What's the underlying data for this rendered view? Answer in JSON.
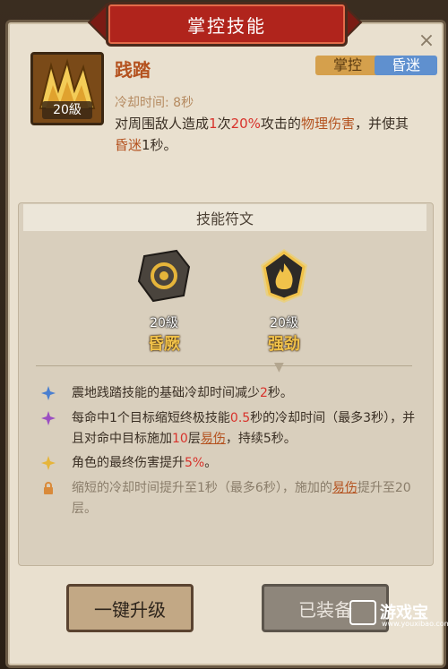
{
  "title": "掌控技能",
  "close_label": "×",
  "skill": {
    "name": "践踏",
    "level_badge": "20級",
    "tags": [
      "掌控",
      "昏迷"
    ],
    "cooldown": "冷却时间: 8秒",
    "description_parts": {
      "p1": "对周围敌人造成",
      "p2": "1",
      "p3": "次",
      "p4": "20%",
      "p5": "攻击的",
      "p6": "物理伤害",
      "p7": "，并使其",
      "p8": "昏迷",
      "p9": "1秒。"
    }
  },
  "runes": {
    "header": "技能符文",
    "items": [
      {
        "level": "20級",
        "name": "昏厥"
      },
      {
        "level": "20級",
        "name": "强劲"
      }
    ]
  },
  "effects": [
    {
      "icon": "blue-star-icon",
      "text_a": "震地践踏技能的基础冷却时间减少",
      "text_b": "2",
      "text_c": "秒。"
    },
    {
      "icon": "purple-star-icon",
      "text_a": "每命中1个目标缩短终极技能",
      "text_b": "0.5",
      "text_c": "秒的冷却时间（最多3秒），并且对命中目标施加",
      "text_d": "10",
      "text_e": "层",
      "text_f": "易伤",
      "text_g": "，持续5秒。"
    },
    {
      "icon": "yellow-star-icon",
      "text_a": "角色的最终伤害提升",
      "text_b": "5%",
      "text_c": "。"
    },
    {
      "icon": "lock-icon",
      "text_a": "缩短的冷却时间提升至1秒（最多6秒），施加的",
      "text_b": "易伤",
      "text_c": "提升至20层。"
    }
  ],
  "buttons": {
    "upgrade": "一键升级",
    "equipped": "已装备"
  },
  "watermark": {
    "text": "游戏宝",
    "sub": "www.youxibao.com"
  },
  "colors": {
    "banner_red": "#b0241c",
    "panel_bg": "#e9e0cf",
    "accent_red": "#d8322b",
    "accent_brown": "#b4521f",
    "rune_gold": "#f1c24a",
    "tag_ctrl": "#d5a04c",
    "tag_stun": "#5f90cf"
  }
}
